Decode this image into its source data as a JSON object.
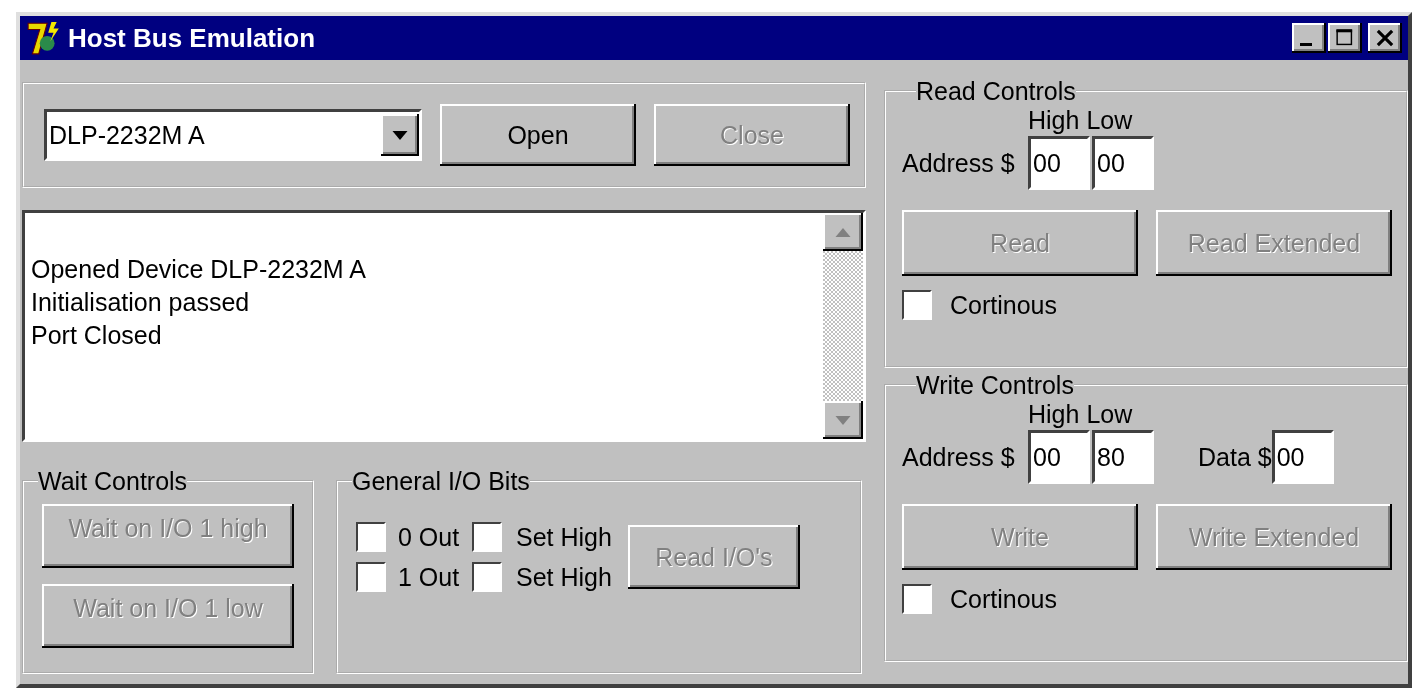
{
  "window": {
    "title": "Host Bus Emulation"
  },
  "device": {
    "value": "DLP-2232M A"
  },
  "buttons": [
    {
      "label": "Open",
      "disabled": false
    },
    {
      "label": "Close",
      "disabled": true
    }
  ],
  "log": {
    "lines": [
      "Opened Device DLP-2232M A",
      "Initialisation passed",
      "Port Closed"
    ]
  },
  "wait_controls": {
    "title": "Wait Controls",
    "buttons": [
      {
        "label": "Wait on I/O 1 high",
        "disabled": true
      },
      {
        "label": "Wait on I/O 1 low",
        "disabled": true
      }
    ]
  },
  "general_io": {
    "title": "General I/O Bits",
    "bits": [
      {
        "label": "0 Out",
        "checked": false,
        "set_label": "Set High",
        "set_checked": false
      },
      {
        "label": "1 Out",
        "checked": false,
        "set_label": "Set High",
        "set_checked": false
      }
    ],
    "button": {
      "label": "Read I/O's",
      "disabled": true
    }
  },
  "read_controls": {
    "title": "Read Controls",
    "high_label": "High",
    "low_label": "Low",
    "address_label": "Address $",
    "address_high": "00",
    "address_low": "00",
    "buttons": [
      {
        "label": "Read",
        "disabled": true
      },
      {
        "label": "Read Extended",
        "disabled": true
      }
    ],
    "continuous": {
      "label": "Cortinous",
      "checked": false
    }
  },
  "write_controls": {
    "title": "Write Controls",
    "high_label": "High",
    "low_label": "Low",
    "address_label": "Address $",
    "address_high": "00",
    "address_low": "80",
    "data_label": "Data $",
    "data": "00",
    "buttons": [
      {
        "label": "Write",
        "disabled": true
      },
      {
        "label": "Write Extended",
        "disabled": true
      }
    ],
    "continuous": {
      "label": "Cortinous",
      "checked": false
    }
  }
}
